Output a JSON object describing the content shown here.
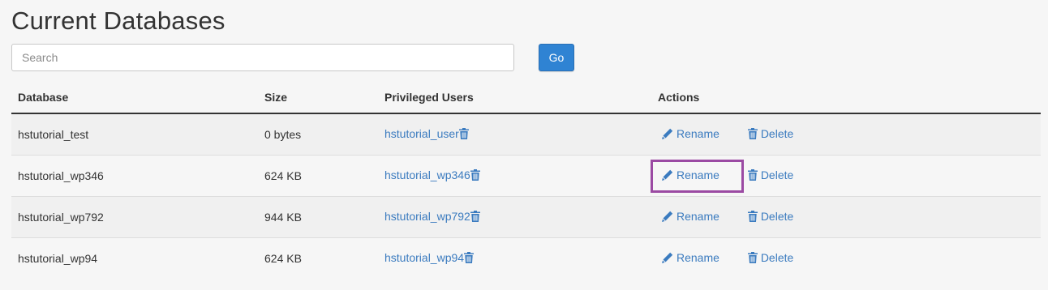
{
  "page_title": "Current Databases",
  "search": {
    "placeholder": "Search",
    "go_label": "Go"
  },
  "table": {
    "headers": {
      "database": "Database",
      "size": "Size",
      "privileged_users": "Privileged Users",
      "actions": "Actions"
    },
    "rows": [
      {
        "database": "hstutorial_test",
        "size": "0 bytes",
        "user": "hstutorial_user",
        "rename": "Rename",
        "delete": "Delete"
      },
      {
        "database": "hstutorial_wp346",
        "size": "624 KB",
        "user": "hstutorial_wp346",
        "rename": "Rename",
        "delete": "Delete"
      },
      {
        "database": "hstutorial_wp792",
        "size": "944 KB",
        "user": "hstutorial_wp792",
        "rename": "Rename",
        "delete": "Delete"
      },
      {
        "database": "hstutorial_wp94",
        "size": "624 KB",
        "user": "hstutorial_wp94",
        "rename": "Rename",
        "delete": "Delete"
      }
    ]
  },
  "icons": {
    "remove_user": "trash-icon",
    "rename": "pencil-icon",
    "delete": "trash-icon"
  },
  "colors": {
    "link": "#3b7bbf",
    "go_button": "#2f83d3",
    "highlight": "#9b4aa3"
  }
}
